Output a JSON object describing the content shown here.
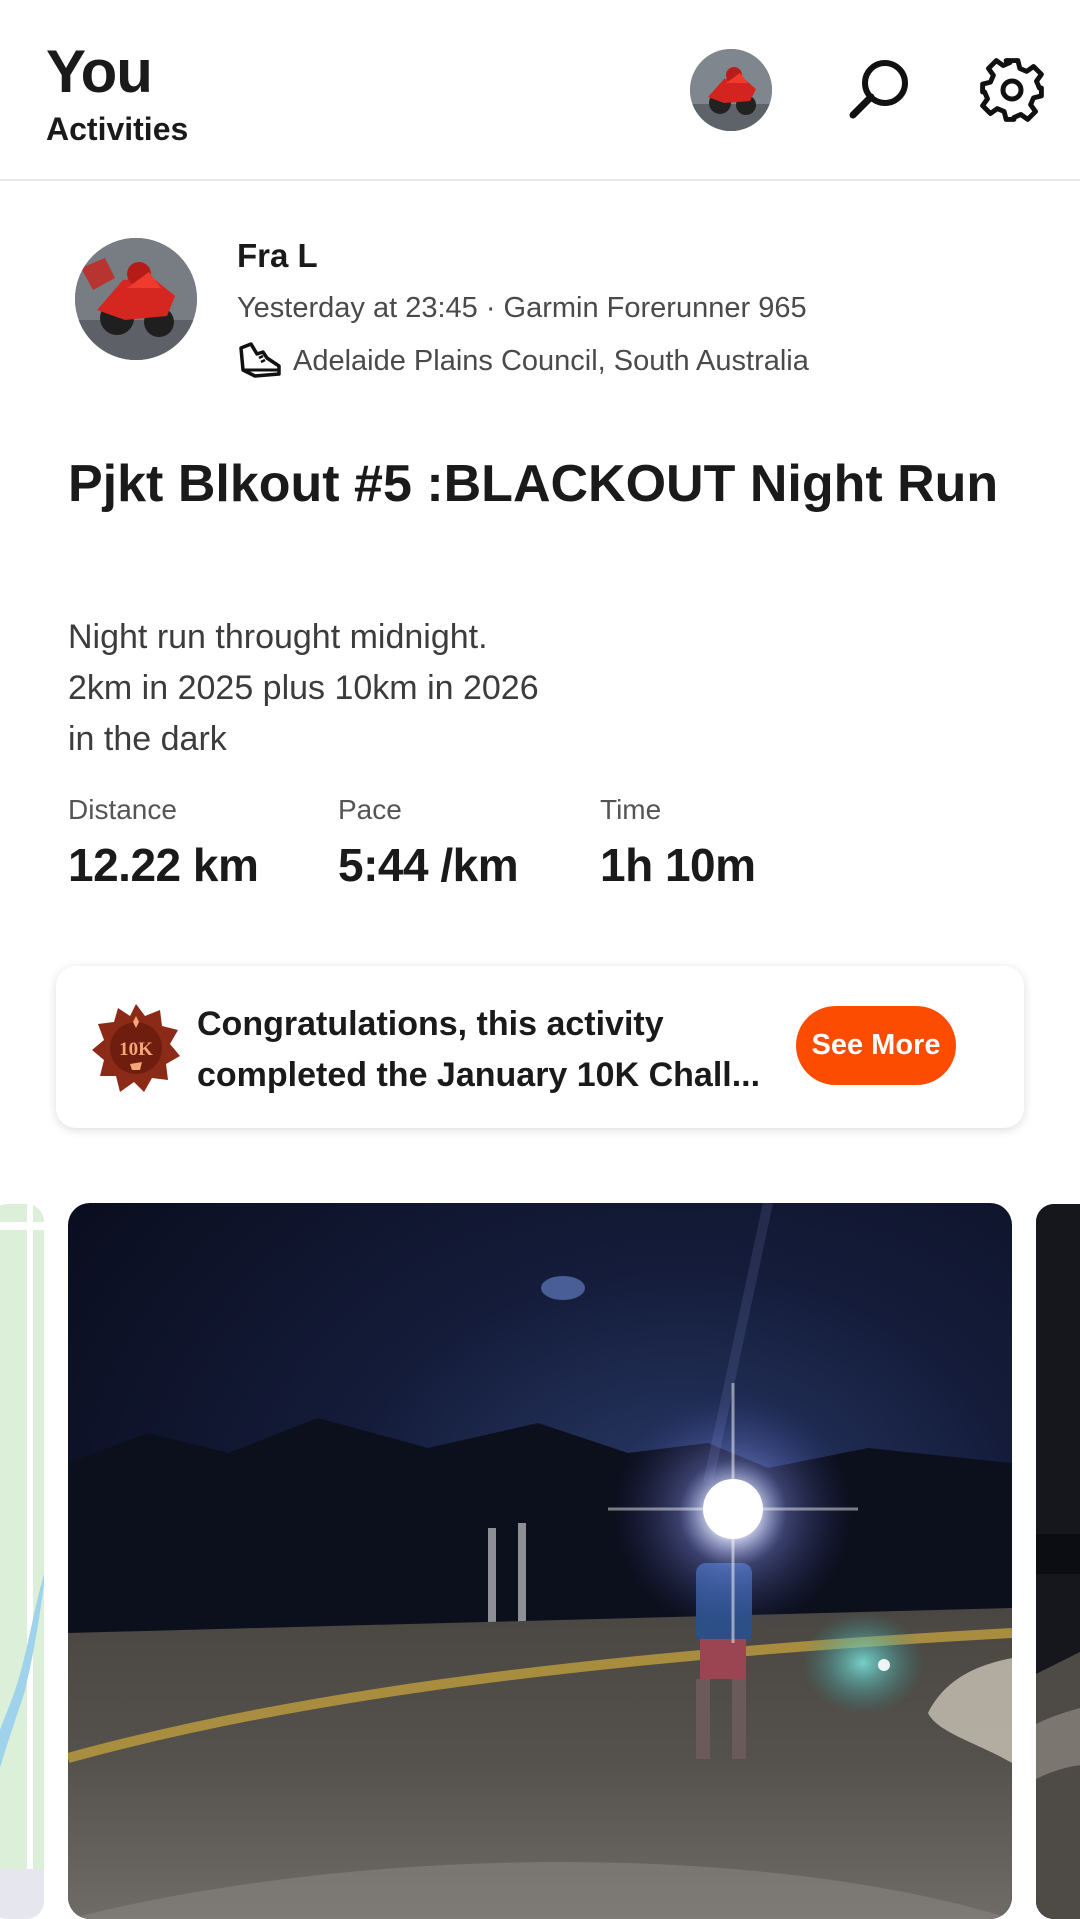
{
  "header": {
    "title": "You",
    "subtitle": "Activities",
    "avatar_icon": "profile-avatar",
    "search_icon": "search-icon",
    "settings_icon": "gear-icon"
  },
  "activity": {
    "athlete_name": "Fra L",
    "meta": "Yesterday at 23:45 · Garmin Forerunner 965",
    "sport_icon": "running-shoe-icon",
    "location": "Adelaide Plains Council, South Australia",
    "title": "Pjkt Blkout #5 :BLACKOUT Night Run",
    "description_lines": [
      "Night run throught midnight.",
      "2km in 2025 plus 10km in 2026",
      "in the dark"
    ],
    "stats": [
      {
        "label": "Distance",
        "value": "12.22 km"
      },
      {
        "label": "Pace",
        "value": "5:44 /km"
      },
      {
        "label": "Time",
        "value": "1h 10m"
      }
    ]
  },
  "challenge": {
    "badge_icon": "10k-badge-icon",
    "badge_text": "10K",
    "text_lines": [
      "Congratulations, this activity",
      "completed the January 10K Chall..."
    ],
    "button_label": "See More"
  },
  "media": {
    "items": [
      "route-map",
      "night-run-photo",
      "next-photo"
    ]
  },
  "colors": {
    "accent": "#fc4c02",
    "text": "#1a1a1a",
    "muted": "#4a4a4a"
  }
}
